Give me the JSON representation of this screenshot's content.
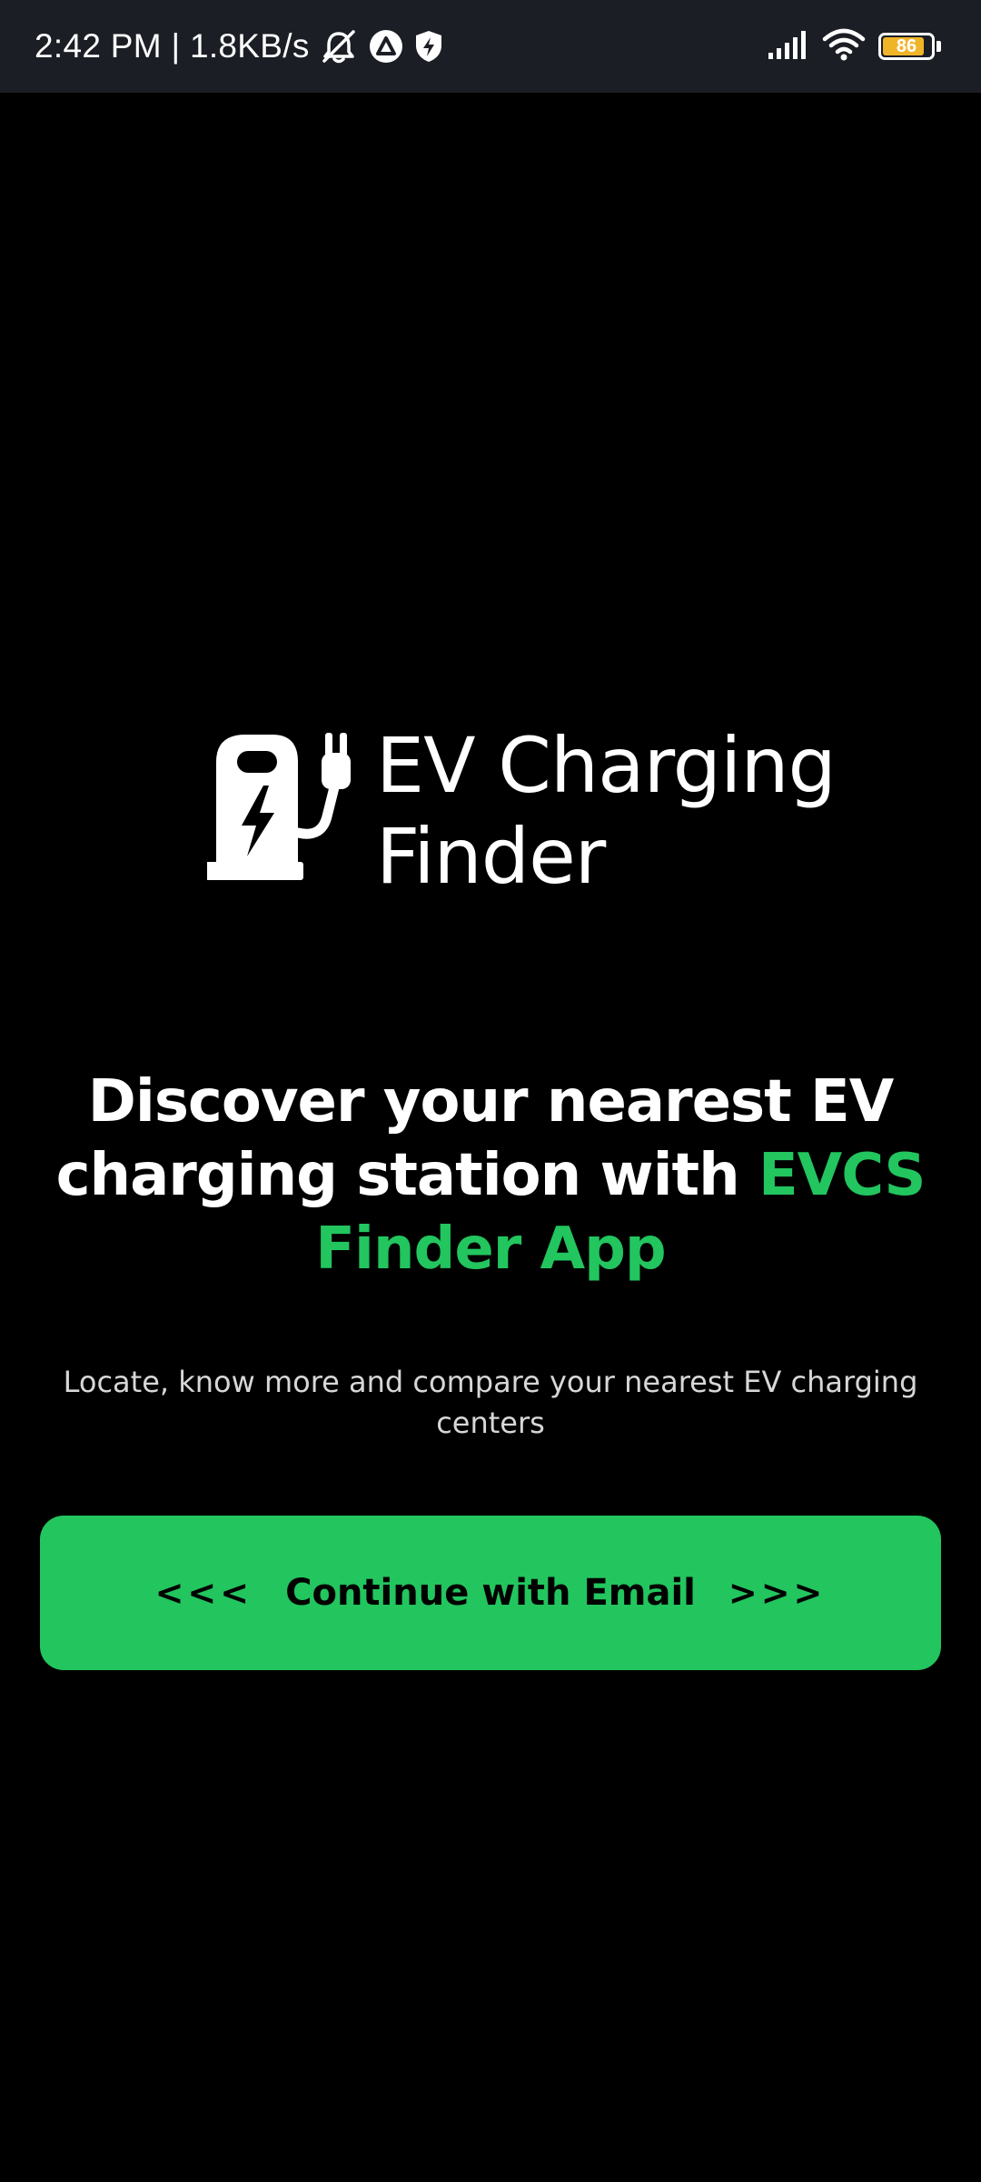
{
  "status_bar": {
    "time_speed": "2:42 PM | 1.8KB/s",
    "battery_level": "86",
    "battery_fraction": 0.86
  },
  "logo": {
    "line1": "EV Charging",
    "line2": "Finder"
  },
  "headline": {
    "part1": "Discover your nearest EV charging station with ",
    "accent": "EVCS Finder App",
    "accent_color": "#22c55e"
  },
  "subtitle": "Locate, know more and compare your nearest EV charging centers",
  "cta": {
    "left_chevrons": "<<<",
    "label": "Continue with Email",
    "right_chevrons": ">>>",
    "color": "#22c55e"
  }
}
